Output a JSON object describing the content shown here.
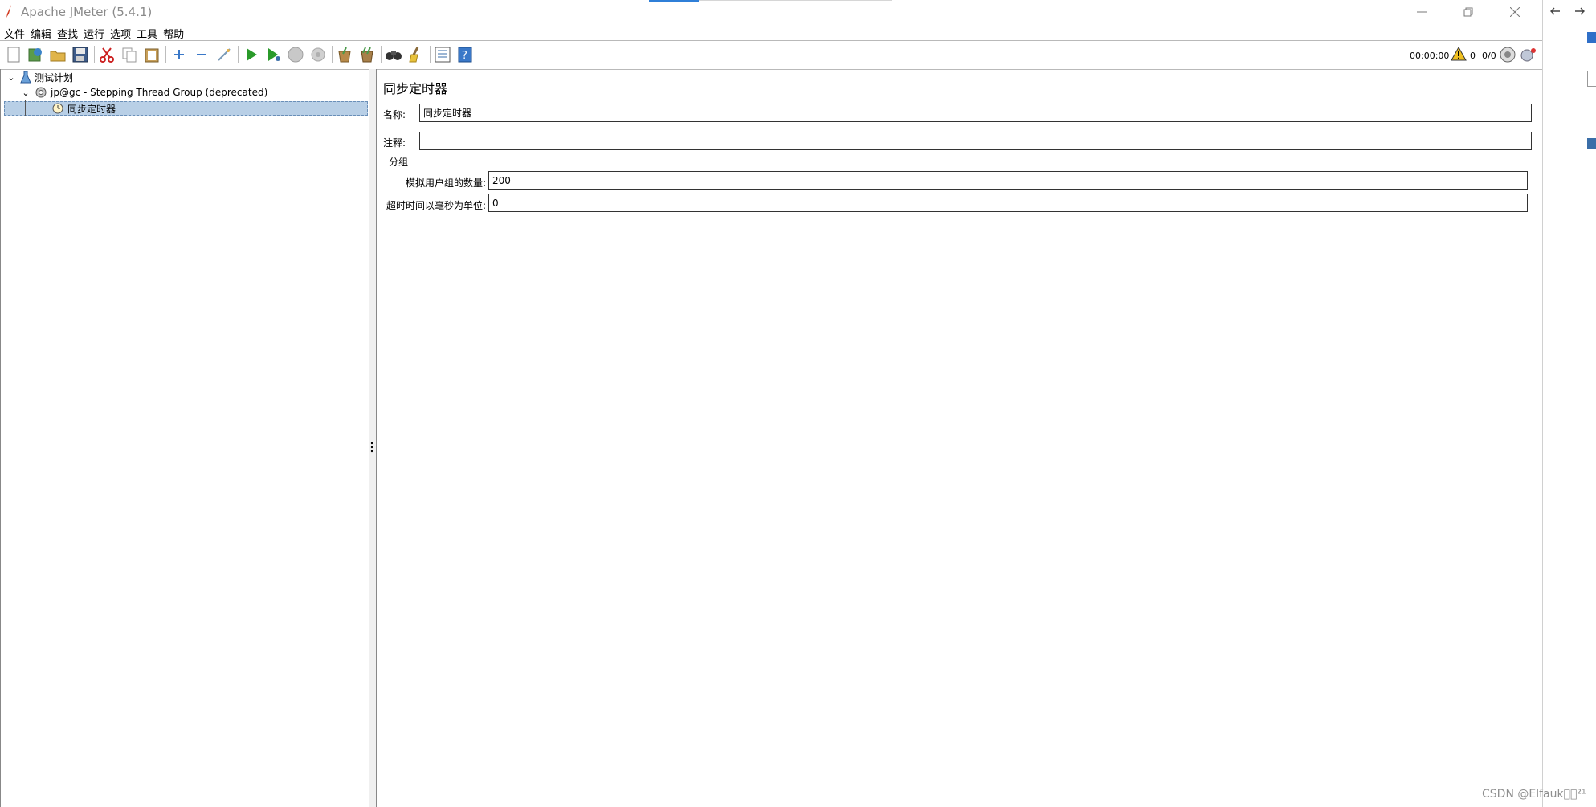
{
  "window": {
    "title": "Apache JMeter (5.4.1)"
  },
  "menu": [
    "文件",
    "编辑",
    "查找",
    "运行",
    "选项",
    "工具",
    "帮助"
  ],
  "toolbar": {
    "icons": [
      "new-icon",
      "templates-icon",
      "open-icon",
      "save-icon",
      "cut-icon",
      "copy-icon",
      "paste-icon",
      "expand-icon",
      "collapse-icon",
      "toggle-icon",
      "start-icon",
      "start-no-pause-icon",
      "stop-icon",
      "shutdown-icon",
      "clear-icon",
      "clear-all-icon",
      "search-icon",
      "reset-search-icon",
      "function-helper-icon",
      "help-icon"
    ],
    "elapsed_time": "00:00:00",
    "warning_count": "0",
    "active_threads": "0/0"
  },
  "tree": {
    "test_plan": "测试计划",
    "thread_group": "jp@gc - Stepping Thread Group (deprecated)",
    "timer": "同步定时器"
  },
  "panel": {
    "title": "同步定时器",
    "name_label": "名称:",
    "name_value": "同步定时器",
    "comment_label": "注释:",
    "comment_value": "",
    "group_legend": "分组",
    "users_label": "模拟用户组的数量:",
    "users_value": "200",
    "timeout_label": "超时时间以毫秒为单位:",
    "timeout_value": "0"
  },
  "watermark": "CSDN @Elfauk\u0000\u0000²¹",
  "colors": {
    "selection": "#b8cfe6",
    "title_accent": "#2f7fd8"
  }
}
